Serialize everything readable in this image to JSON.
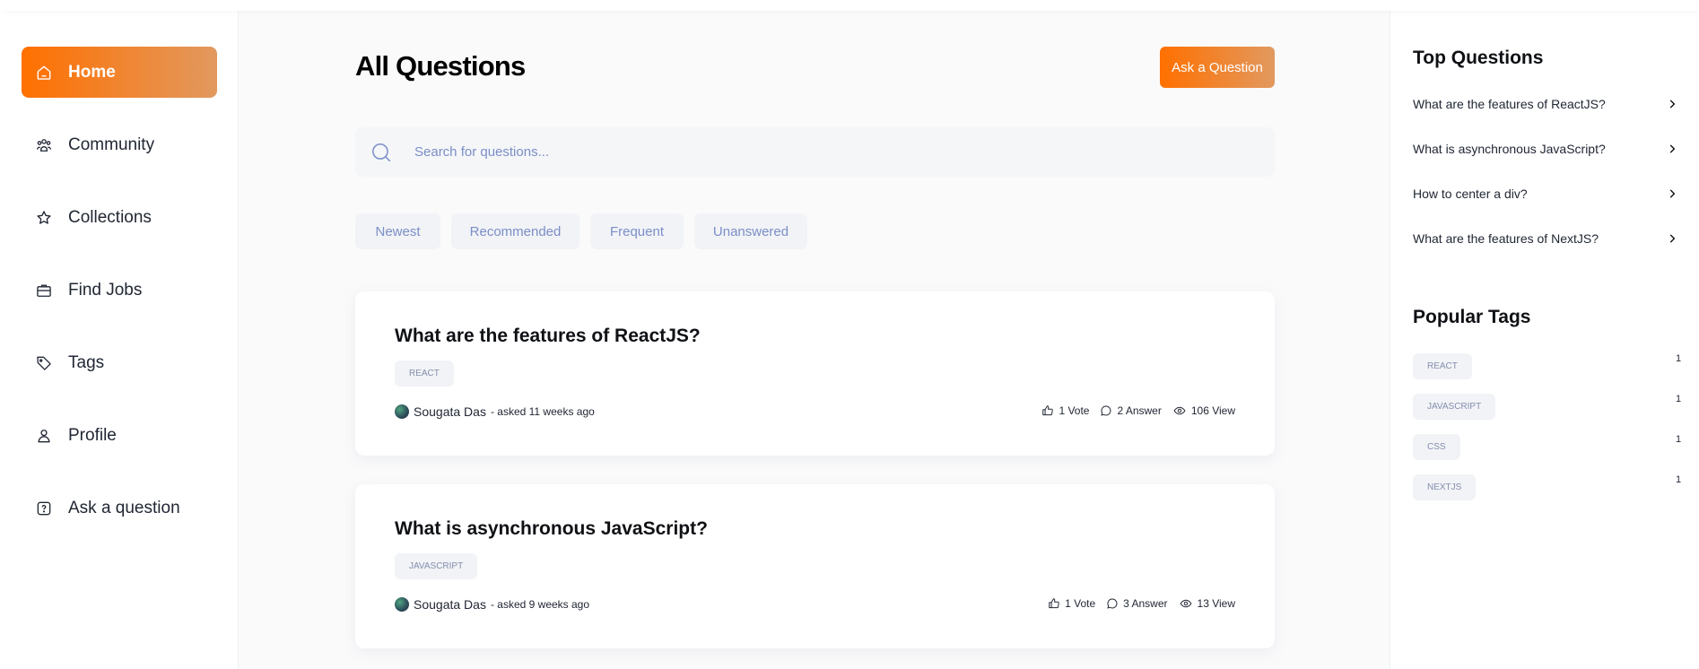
{
  "nav": {
    "items": [
      {
        "label": "Home",
        "icon": "home-icon",
        "active": true
      },
      {
        "label": "Community",
        "icon": "users-icon"
      },
      {
        "label": "Collections",
        "icon": "star-icon"
      },
      {
        "label": "Find Jobs",
        "icon": "briefcase-icon"
      },
      {
        "label": "Tags",
        "icon": "tag-icon"
      },
      {
        "label": "Profile",
        "icon": "user-icon"
      },
      {
        "label": "Ask a question",
        "icon": "question-icon"
      }
    ]
  },
  "main": {
    "title": "All Questions",
    "ask_button": "Ask a Question",
    "search_placeholder": "Search for questions...",
    "filters": [
      "Newest",
      "Recommended",
      "Frequent",
      "Unanswered"
    ],
    "questions": [
      {
        "title": "What are the features of ReactJS?",
        "tag": "REACT",
        "author": "Sougata Das",
        "asked": "- asked 11 weeks ago",
        "votes": "1 Vote",
        "answers": "2 Answer",
        "views": "106 View"
      },
      {
        "title": "What is asynchronous JavaScript?",
        "tag": "JAVASCRIPT",
        "author": "Sougata Das",
        "asked": "- asked 9 weeks ago",
        "votes": "1 Vote",
        "answers": "3 Answer",
        "views": "13 View"
      }
    ]
  },
  "right": {
    "top_title": "Top Questions",
    "top_questions": [
      "What are the features of ReactJS?",
      "What is asynchronous JavaScript?",
      "How to center a div?",
      "What are the features of NextJS?"
    ],
    "tags_title": "Popular Tags",
    "tags": [
      {
        "name": "REACT",
        "count": "1"
      },
      {
        "name": "JAVASCRIPT",
        "count": "1"
      },
      {
        "name": "CSS",
        "count": "1"
      },
      {
        "name": "NEXTJS",
        "count": "1"
      }
    ]
  },
  "colors": {
    "accent_start": "#ff7000",
    "accent_end": "#e2995f",
    "tag_text": "#858ead",
    "filter_text": "#7b8ec8"
  }
}
